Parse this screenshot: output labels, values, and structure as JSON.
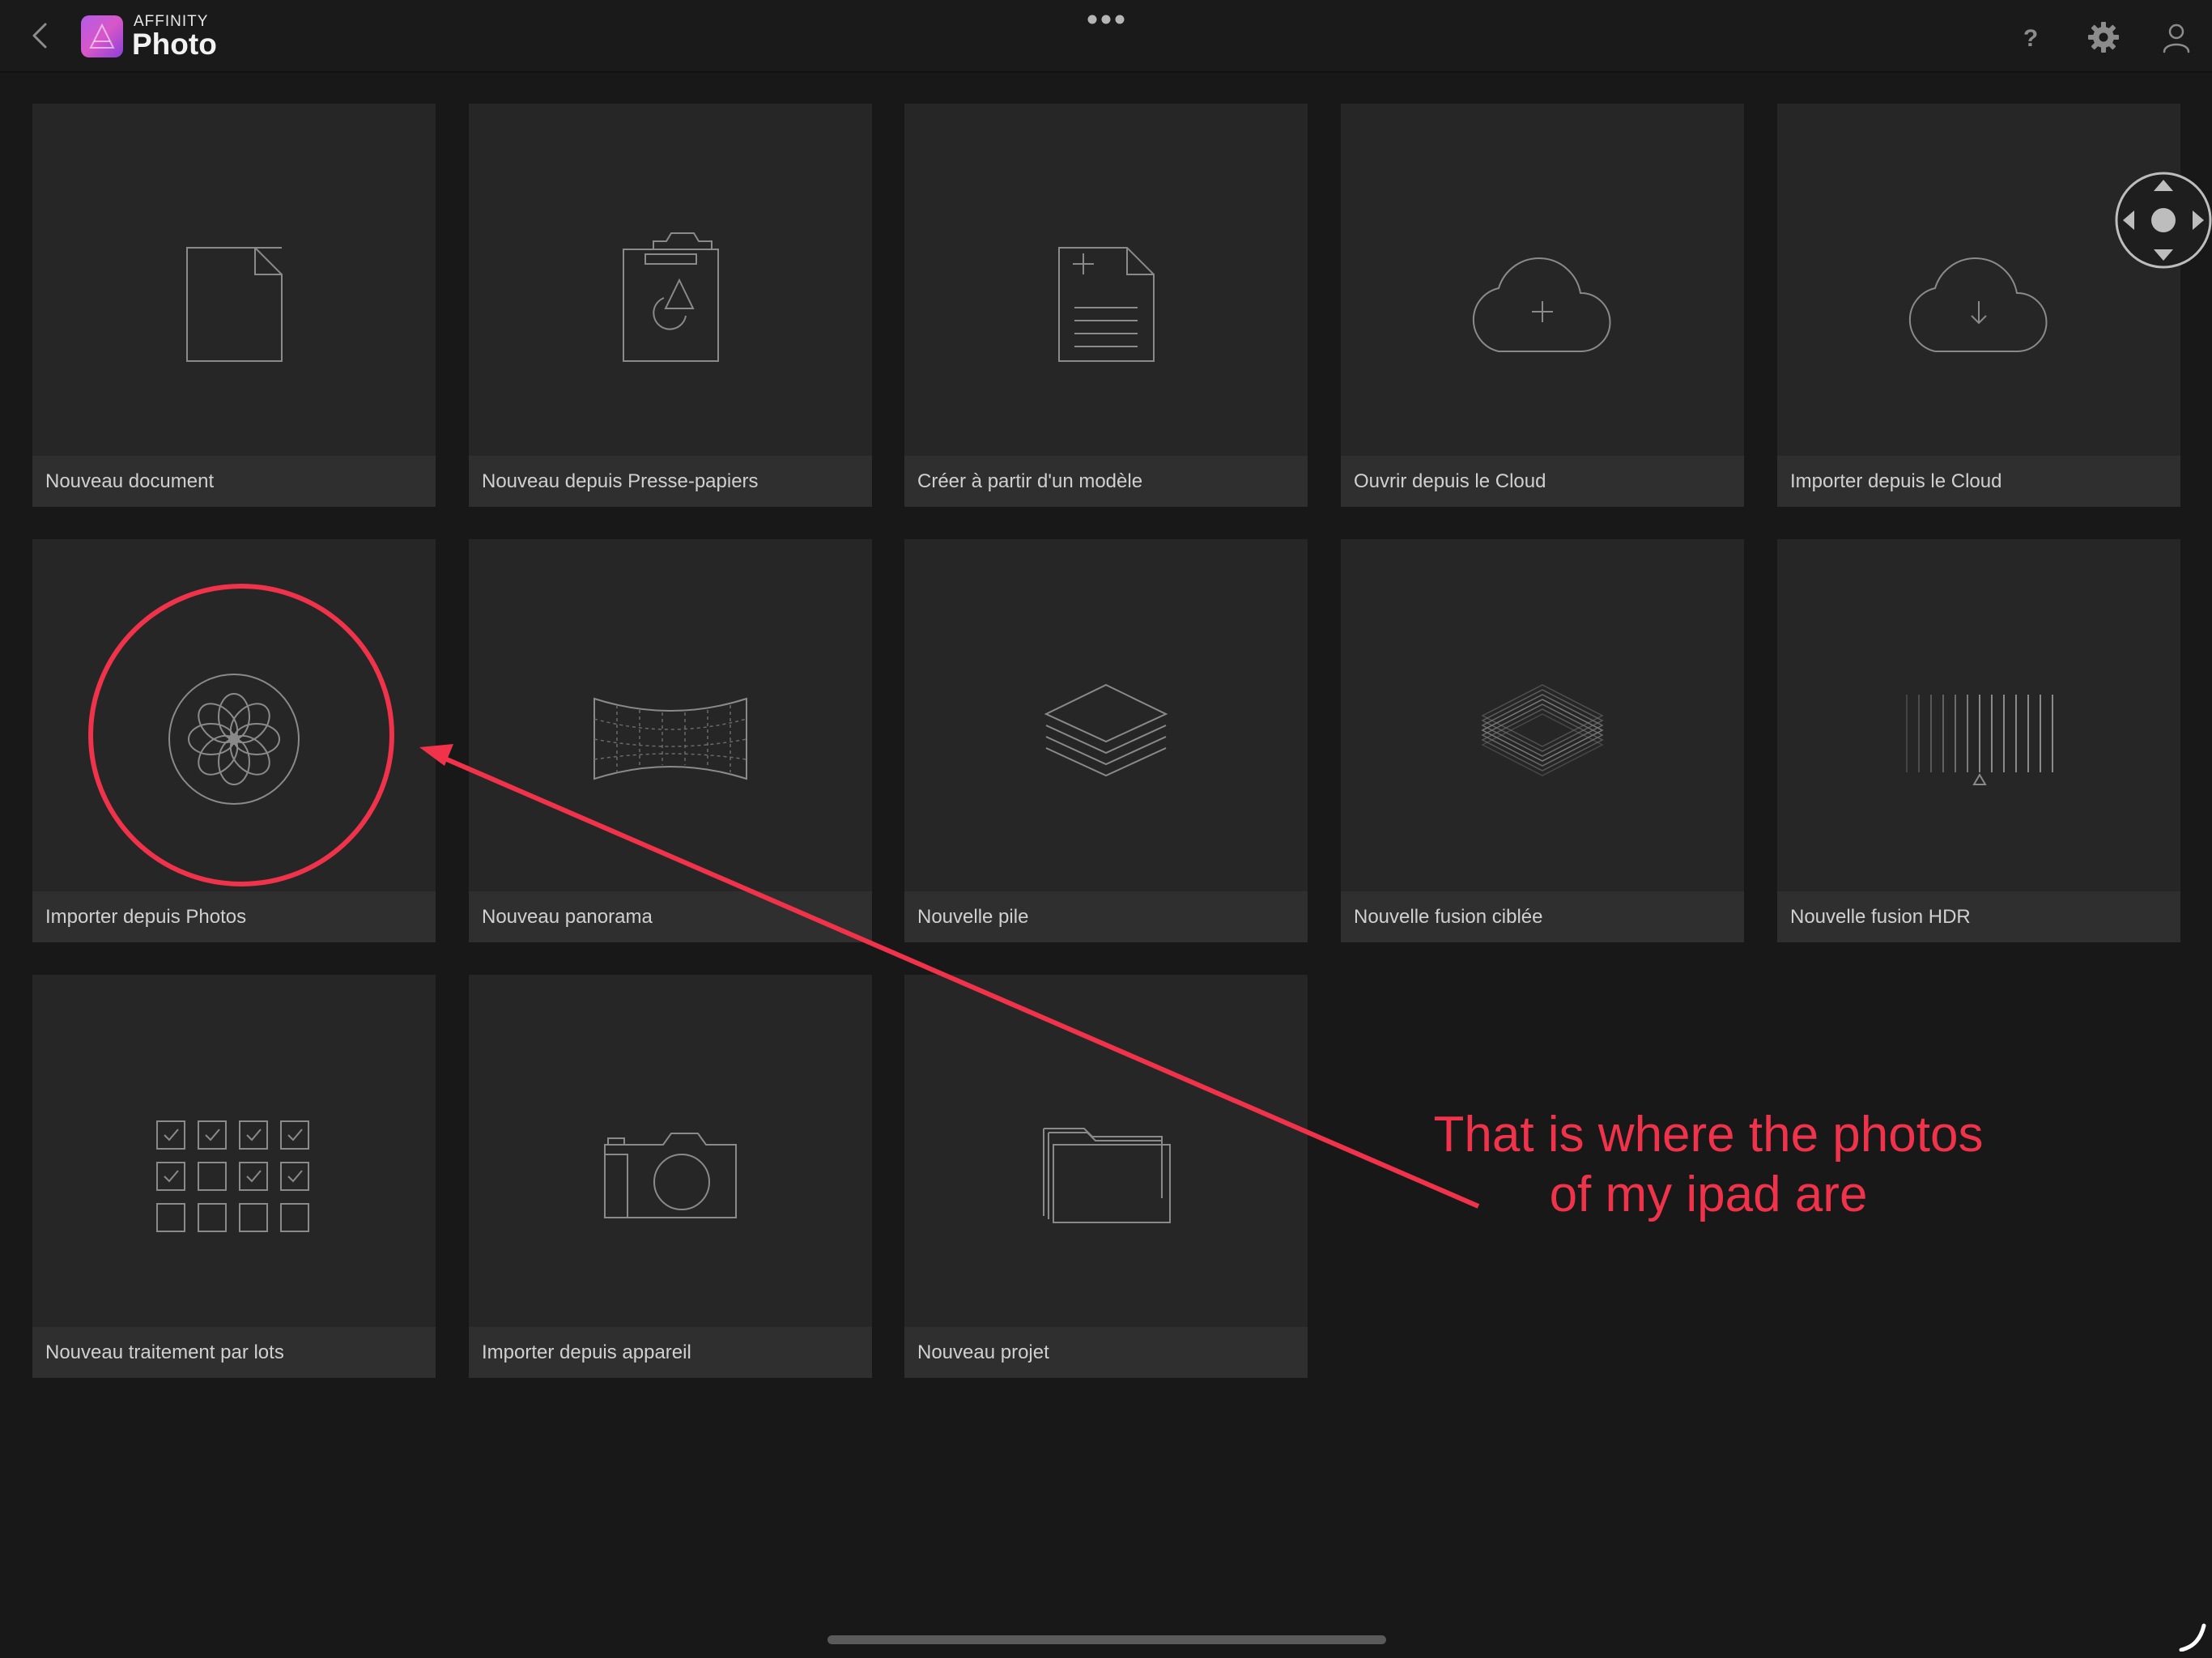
{
  "topbar": {
    "brand_top": "AFFINITY",
    "brand_main": "Photo",
    "icons": [
      "back-chevron-icon",
      "more-dots-icon",
      "help-icon",
      "gear-icon",
      "user-icon"
    ]
  },
  "tiles": [
    {
      "label": "Nouveau document",
      "icon": "document-icon"
    },
    {
      "label": "Nouveau depuis Presse-papiers",
      "icon": "clipboard-icon"
    },
    {
      "label": "Créer à partir d'un modèle",
      "icon": "template-icon"
    },
    {
      "label": "Ouvrir depuis le Cloud",
      "icon": "cloud-plus-icon"
    },
    {
      "label": "Importer depuis le Cloud",
      "icon": "cloud-download-icon"
    },
    {
      "label": "Importer depuis Photos",
      "icon": "photos-flower-icon"
    },
    {
      "label": "Nouveau panorama",
      "icon": "panorama-icon"
    },
    {
      "label": "Nouvelle pile",
      "icon": "layer-stack-icon"
    },
    {
      "label": "Nouvelle fusion ciblée",
      "icon": "focus-merge-icon"
    },
    {
      "label": "Nouvelle fusion HDR",
      "icon": "hdr-merge-icon"
    },
    {
      "label": "Nouveau traitement par lots",
      "icon": "batch-checkbox-icon"
    },
    {
      "label": "Importer depuis appareil",
      "icon": "camera-icon"
    },
    {
      "label": "Nouveau projet",
      "icon": "folder-icon"
    }
  ],
  "annotation": {
    "line1": "That is where the photos",
    "line2": "of my ipad are",
    "color": "#f0334a"
  },
  "colors": {
    "background": "#181818",
    "tile": "#262626",
    "label_bar": "#2f2f2f",
    "icon_stroke": "#8a8a8a"
  }
}
